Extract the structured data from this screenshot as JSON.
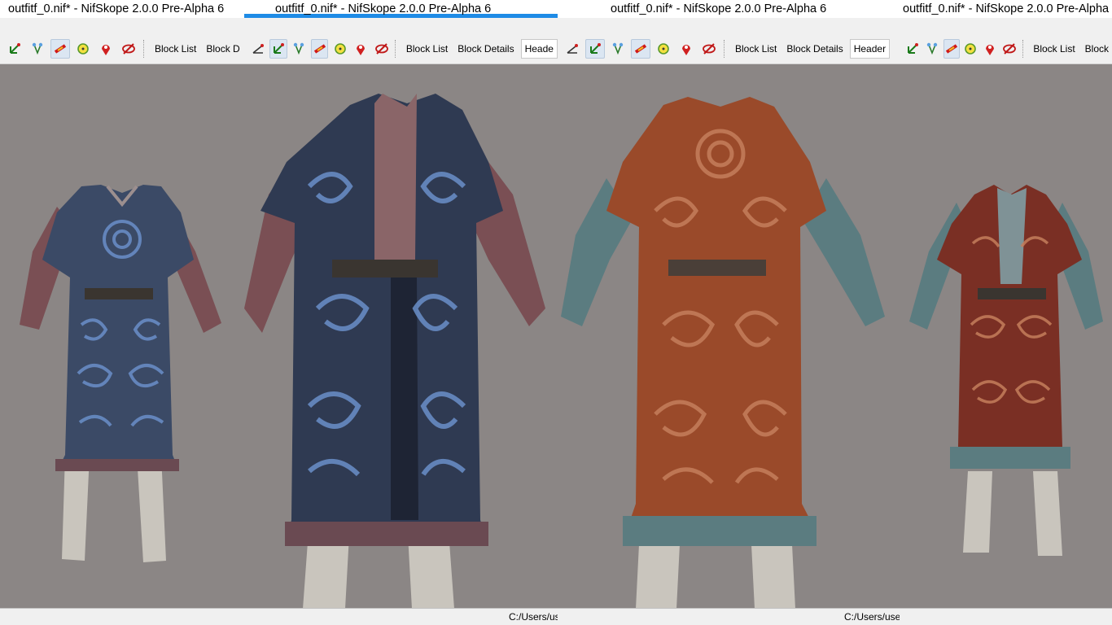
{
  "windows": [
    {
      "title": "outfitf_0.nif* - NifSkope 2.0.0 Pre-Alpha 6",
      "labels": [
        "Block List",
        "Block D"
      ],
      "status": ""
    },
    {
      "title": "outfitf_0.nif* - NifSkope 2.0.0 Pre-Alpha 6",
      "labels": [
        "Block List",
        "Block Details",
        "Heade"
      ],
      "status": "C:/Users/us"
    },
    {
      "title": "outfitf_0.nif* - NifSkope 2.0.0 Pre-Alpha 6",
      "labels": [
        "Block List",
        "Block Details",
        "Header"
      ],
      "status": "C:/Users/user,"
    },
    {
      "title": "outfitf_0.nif* - NifSkope 2.0.0 Pre-Alpha",
      "labels": [
        "Block List",
        "Block"
      ],
      "status": ""
    }
  ],
  "toolbar_icons": [
    "select-axes-icon",
    "connect-icon",
    "bone-icon",
    "light-bulb-icon",
    "location-pin-icon",
    "hide-icon"
  ],
  "colors": {
    "viewport_bg": "#8b8685",
    "robe_blue": "#3b4a66",
    "robe_blue_pattern": "#6a8fc9",
    "robe_red": "#9a4a2a",
    "robe_red_pattern": "#c57e5c",
    "sleeve_pink": "#7a4f54",
    "sleeve_teal": "#5b7c80",
    "title_accent": "#1e8be6"
  }
}
